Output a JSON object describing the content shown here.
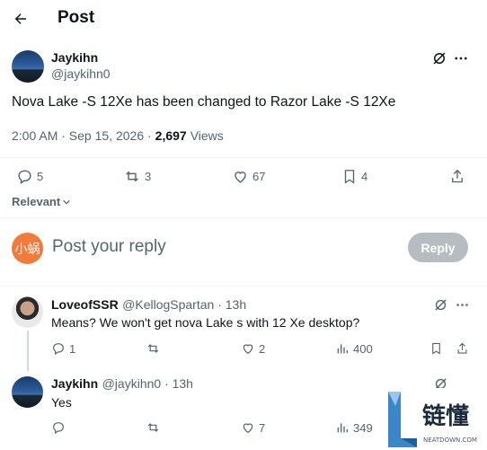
{
  "header": {
    "title": "Post"
  },
  "post": {
    "author_name": "Jaykihn",
    "author_handle": "@jaykihn0",
    "text": "Nova Lake -S 12Xe has been changed to Razor Lake -S 12Xe",
    "time": "2:00 AM · Sep 15, 2026 ·",
    "views_count": "2,697",
    "views_label": "Views",
    "actions": {
      "replies": "5",
      "reposts": "3",
      "likes": "67",
      "bookmarks": "4"
    }
  },
  "sort": {
    "label": "Relevant"
  },
  "composer": {
    "avatar_text": "小蜗",
    "placeholder": "Post your reply",
    "reply_label": "Reply"
  },
  "replies": [
    {
      "name": "LoveofSSR",
      "handle": "@KellogSpartan · 13h",
      "text": "Means? We won't get nova Lake s with 12 Xe desktop?",
      "replies": "1",
      "reposts": "",
      "likes": "2",
      "views": "400"
    },
    {
      "name": "Jaykihn",
      "handle": "@jaykihn0 · 13h",
      "text": "Yes",
      "replies": "",
      "reposts": "",
      "likes": "7",
      "views": "349"
    }
  ],
  "watermark": {
    "text": "链懂",
    "sub": "NEATDOWN.COM"
  },
  "colors": {
    "text": "#0f1419",
    "muted": "#536471",
    "reply_btn": "#b7bcc0",
    "divider": "#eff3f4"
  }
}
